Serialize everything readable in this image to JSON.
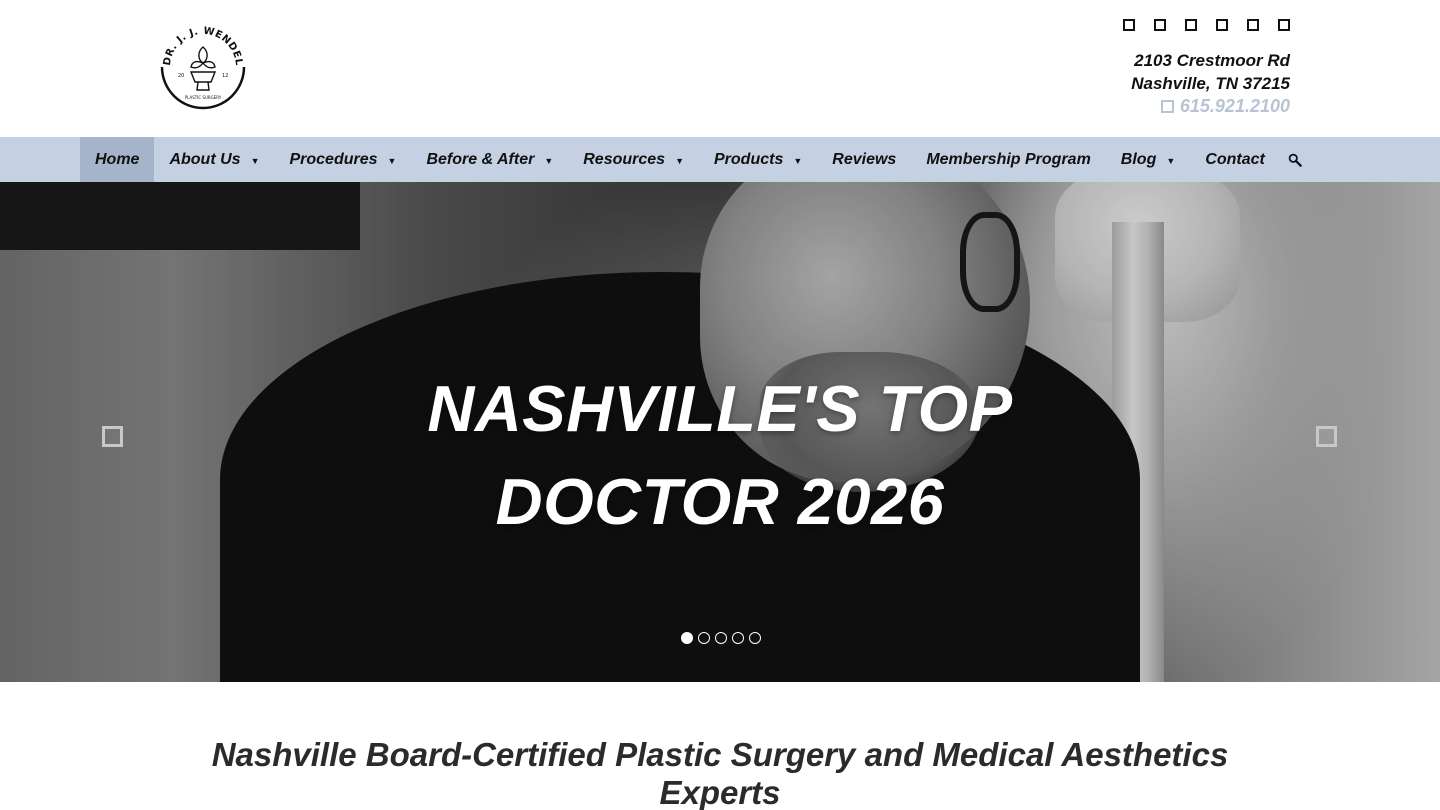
{
  "header": {
    "logo": {
      "arc_text": "DR. J. J. WENDEL",
      "year_left": "20",
      "year_right": "12",
      "sub_text": "PLASTIC SURGERY"
    },
    "social_icons": [
      "social-icon-1",
      "social-icon-2",
      "social-icon-3",
      "social-icon-4",
      "social-icon-5",
      "social-icon-6"
    ],
    "address_line1": "2103 Crestmoor Rd",
    "address_line2": "Nashville, TN 37215",
    "phone": "615.921.2100",
    "phone_icon": "phone-icon"
  },
  "nav": {
    "items": [
      {
        "label": "Home",
        "active": true,
        "dropdown": false
      },
      {
        "label": "About Us",
        "active": false,
        "dropdown": true
      },
      {
        "label": "Procedures",
        "active": false,
        "dropdown": true
      },
      {
        "label": "Before & After",
        "active": false,
        "dropdown": true
      },
      {
        "label": "Resources",
        "active": false,
        "dropdown": true
      },
      {
        "label": "Products",
        "active": false,
        "dropdown": true
      },
      {
        "label": "Reviews",
        "active": false,
        "dropdown": false
      },
      {
        "label": "Membership Program",
        "active": false,
        "dropdown": false
      },
      {
        "label": "Blog",
        "active": false,
        "dropdown": true
      },
      {
        "label": "Contact",
        "active": false,
        "dropdown": false
      }
    ],
    "caret": "▼",
    "search_icon": "search-icon",
    "colors": {
      "bar": "#c5d0e2",
      "active": "#a5b3cb"
    }
  },
  "hero": {
    "title_line1": "NASHVILLE'S TOP",
    "title_line2": "DOCTOR 2026",
    "slide_count": 5,
    "active_slide": 1
  },
  "intro": {
    "heading": "Nashville Board-Certified Plastic Surgery and Medical Aesthetics Experts"
  }
}
